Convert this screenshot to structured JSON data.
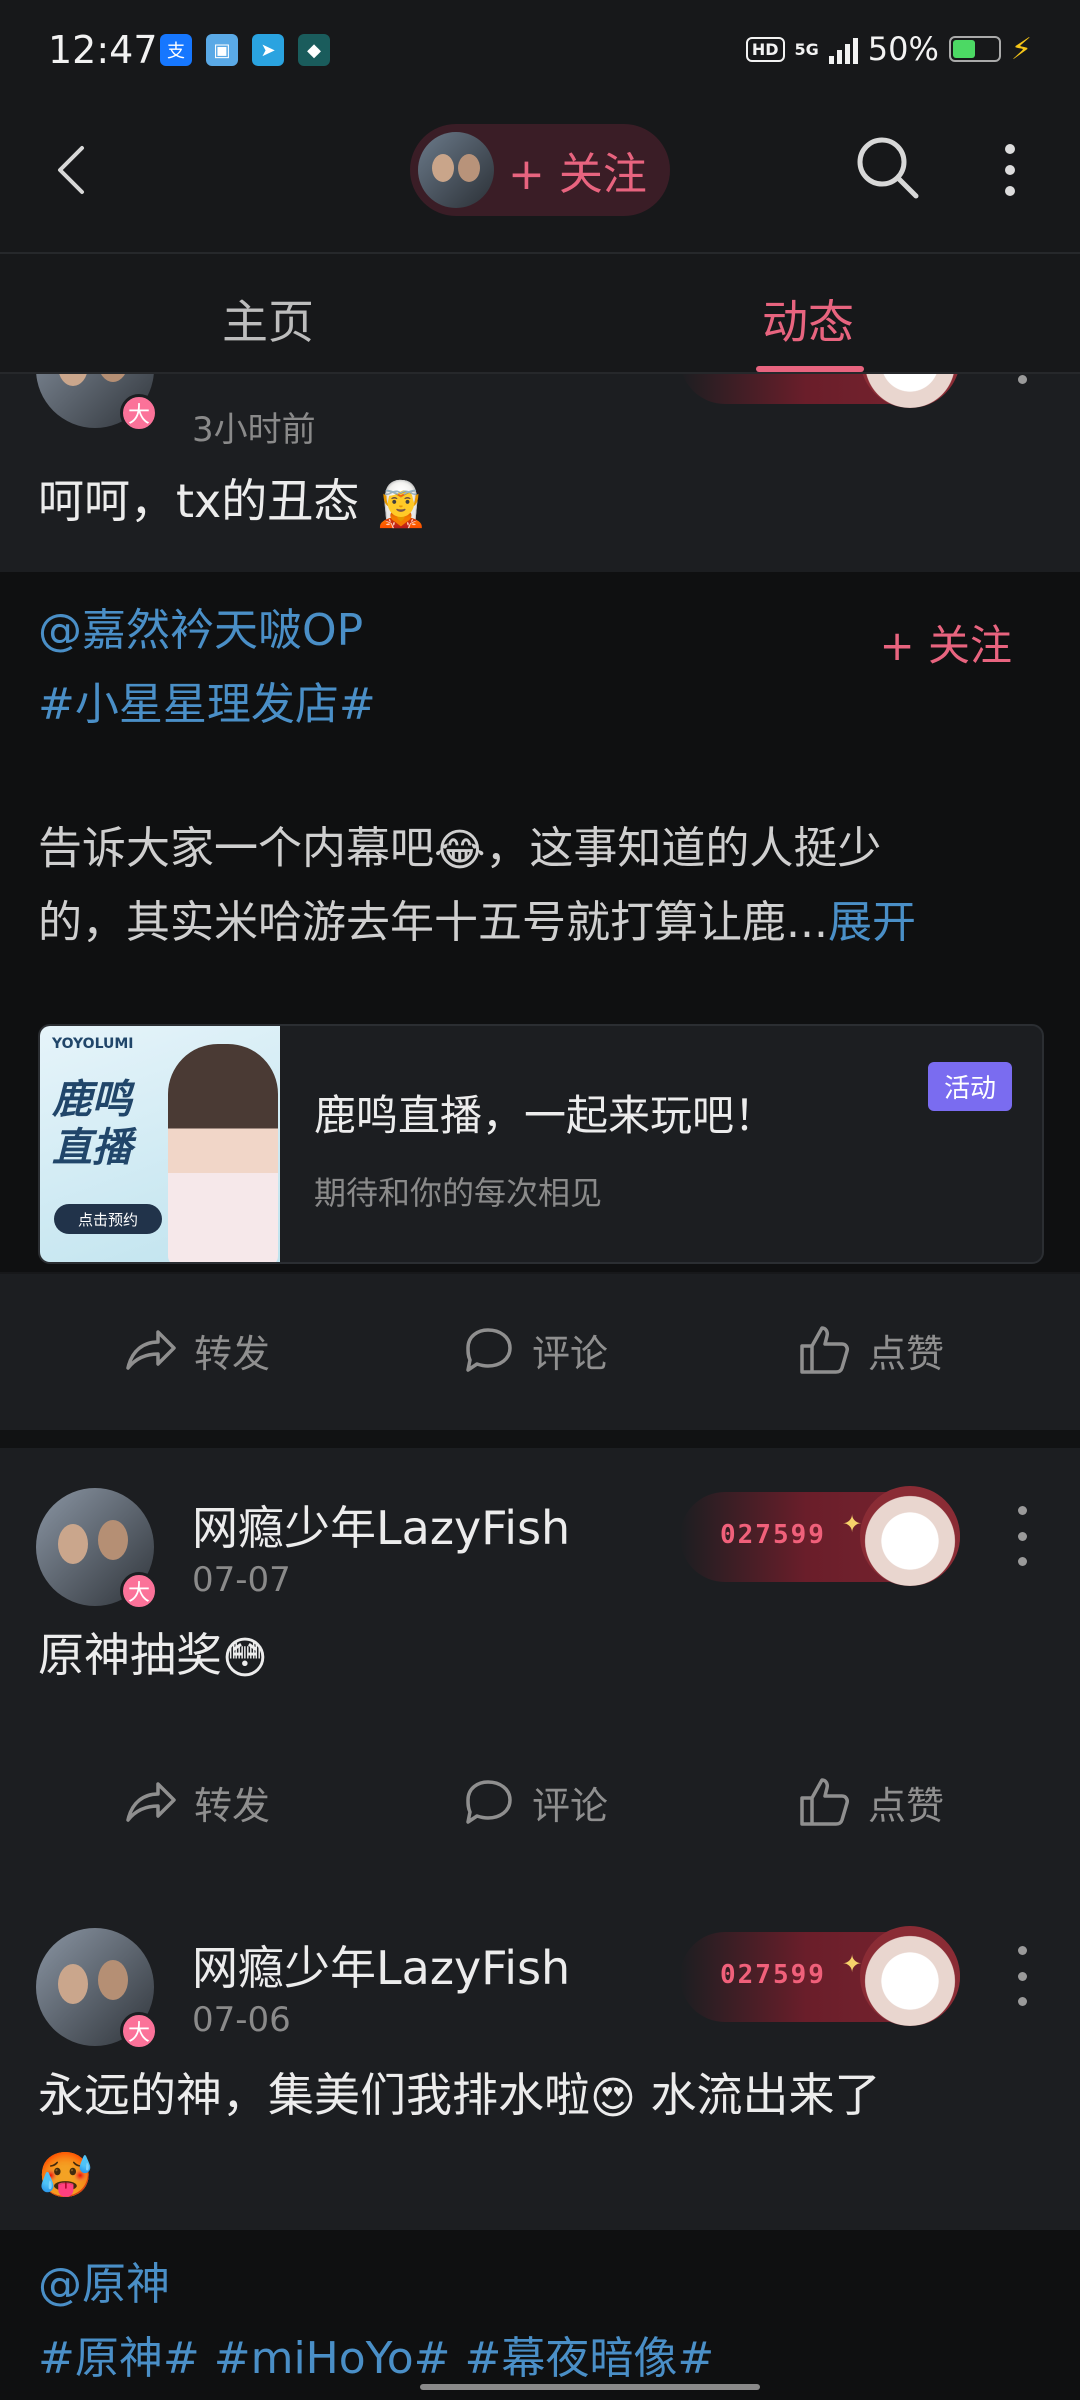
{
  "status_bar": {
    "time": "12:47",
    "hd": "HD",
    "network": "5G",
    "battery_percent": "50%",
    "battery_level": 0.5,
    "app_icons": [
      "alipay-icon",
      "gallery-icon",
      "telegram-icon",
      "vpn-icon"
    ]
  },
  "header": {
    "follow_label": "+ 关注",
    "accent": "#e8647f"
  },
  "tabs": [
    {
      "label": "主页",
      "active": false
    },
    {
      "label": "动态",
      "active": true
    }
  ],
  "posts": [
    {
      "time": "3小时前",
      "text": "呵呵，tx的丑态"
    },
    {
      "username": "网瘾少年LazyFish",
      "time": "07-07",
      "fan_number": "027599",
      "text": "原神抽奖"
    },
    {
      "username": "网瘾少年LazyFish",
      "time": "07-06",
      "fan_number": "027599",
      "text_line1": "永远的神，集美们我排水啦",
      "text_line1_tail": "水流出来了"
    }
  ],
  "repost": {
    "mention": "@嘉然衿天啵OP",
    "follow_label": "+ 关注",
    "topic": "#小星星理发店#",
    "text_line1": "告诉大家一个内幕吧",
    "text_line1_tail": "，这事知道的人挺少",
    "text_line2": "的，其实米哈游去年十五号就打算让鹿...",
    "expand_label": "展开",
    "event": {
      "title": "鹿鸣直播，一起来玩吧！",
      "subtitle": "期待和你的每次相见",
      "tag": "活动",
      "image_brand": "YOYOLUMI",
      "image_title_1": "鹿鸣",
      "image_title_2": "直播",
      "image_button": "点击预约"
    }
  },
  "actions": {
    "forward": "转发",
    "comment": "评论",
    "like": "点赞"
  },
  "bottom_repost": {
    "mention": "@原神",
    "topics": "#原神# #miHoYo# #幕夜暗像#"
  }
}
